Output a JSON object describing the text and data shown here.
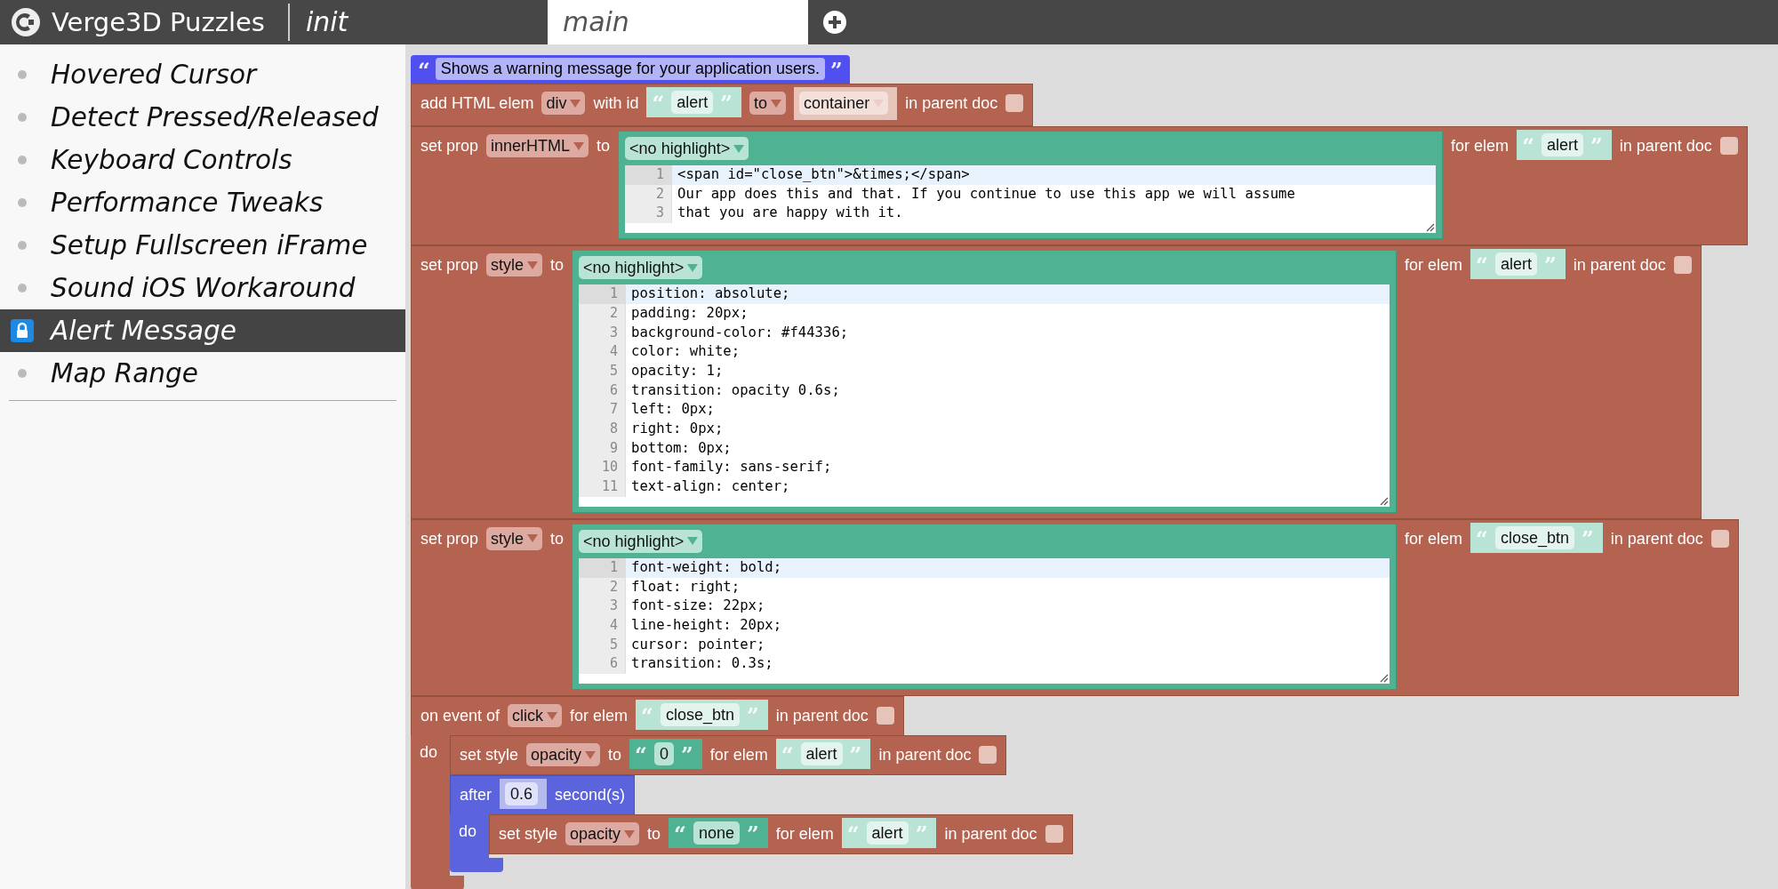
{
  "app_bar": {
    "title": "Verge3D Puzzles",
    "tabs": [
      {
        "label": "init",
        "selected": false
      },
      {
        "label": "main",
        "selected": true
      }
    ]
  },
  "sidebar": {
    "items": [
      {
        "label": "Hovered Cursor",
        "selected": false
      },
      {
        "label": "Detect Pressed/Released",
        "selected": false
      },
      {
        "label": "Keyboard Controls",
        "selected": false
      },
      {
        "label": "Performance Tweaks",
        "selected": false
      },
      {
        "label": "Setup Fullscreen iFrame",
        "selected": false
      },
      {
        "label": "Sound iOS Workaround",
        "selected": false
      },
      {
        "label": "Alert Message",
        "selected": true
      },
      {
        "label": "Map Range",
        "selected": false
      }
    ]
  },
  "workspace": {
    "comment": {
      "open": "“",
      "text": "Shows a warning message for your application users.",
      "close": "”"
    },
    "blocks": [
      {
        "kind": "statement",
        "parts": [
          {
            "kind": "label",
            "text": "add HTML elem"
          },
          {
            "kind": "dropdown",
            "value": "div"
          },
          {
            "kind": "label",
            "text": "with id"
          },
          {
            "kind": "string",
            "open": "“",
            "value": "alert",
            "close": "”"
          },
          {
            "kind": "dropdown",
            "value": "to"
          },
          {
            "kind": "dropdown_block",
            "value": "container",
            "disabled": true
          },
          {
            "kind": "label",
            "text": "in parent doc"
          },
          {
            "kind": "checkbox",
            "checked": false
          }
        ]
      },
      {
        "kind": "statement",
        "parts": [
          {
            "kind": "label",
            "text": "set prop"
          },
          {
            "kind": "dropdown",
            "value": "innerHTML"
          },
          {
            "kind": "label",
            "text": "to"
          },
          {
            "kind": "code",
            "highlight": "<no highlight>",
            "lines": [
              {
                "number": "1",
                "text": "<span id=\"close_btn\">&times;</span>",
                "active": true
              },
              {
                "number": "2",
                "text": "Our app does this and that. If you continue to use this app we will assume",
                "active": false
              },
              {
                "number": "3",
                "text": "that you are happy with it.",
                "active": false
              }
            ]
          },
          {
            "kind": "label",
            "text": "for elem"
          },
          {
            "kind": "string",
            "open": "“",
            "value": "alert",
            "close": "”"
          },
          {
            "kind": "label",
            "text": "in parent doc"
          },
          {
            "kind": "checkbox",
            "checked": false
          }
        ]
      },
      {
        "kind": "statement",
        "parts": [
          {
            "kind": "label",
            "text": "set prop"
          },
          {
            "kind": "dropdown",
            "value": "style"
          },
          {
            "kind": "label",
            "text": "to"
          },
          {
            "kind": "code",
            "highlight": "<no highlight>",
            "lines": [
              {
                "number": "1",
                "text": "position: absolute;",
                "active": true
              },
              {
                "number": "2",
                "text": "padding: 20px;",
                "active": false
              },
              {
                "number": "3",
                "text": "background-color: #f44336;",
                "active": false
              },
              {
                "number": "4",
                "text": "color: white;",
                "active": false
              },
              {
                "number": "5",
                "text": "opacity: 1;",
                "active": false
              },
              {
                "number": "6",
                "text": "transition: opacity 0.6s;",
                "active": false
              },
              {
                "number": "7",
                "text": "left: 0px;",
                "active": false
              },
              {
                "number": "8",
                "text": "right: 0px;",
                "active": false
              },
              {
                "number": "9",
                "text": "bottom: 0px;",
                "active": false
              },
              {
                "number": "10",
                "text": "font-family: sans-serif;",
                "active": false
              },
              {
                "number": "11",
                "text": "text-align: center;",
                "active": false
              }
            ]
          },
          {
            "kind": "label",
            "text": "for elem"
          },
          {
            "kind": "string",
            "open": "“",
            "value": "alert",
            "close": "”"
          },
          {
            "kind": "label",
            "text": "in parent doc"
          },
          {
            "kind": "checkbox",
            "checked": false
          }
        ]
      },
      {
        "kind": "statement",
        "parts": [
          {
            "kind": "label",
            "text": "set prop"
          },
          {
            "kind": "dropdown",
            "value": "style"
          },
          {
            "kind": "label",
            "text": "to"
          },
          {
            "kind": "code",
            "highlight": "<no highlight>",
            "lines": [
              {
                "number": "1",
                "text": "font-weight: bold;",
                "active": true
              },
              {
                "number": "2",
                "text": "float: right;",
                "active": false
              },
              {
                "number": "3",
                "text": "font-size: 22px;",
                "active": false
              },
              {
                "number": "4",
                "text": "line-height: 20px;",
                "active": false
              },
              {
                "number": "5",
                "text": "cursor: pointer;",
                "active": false
              },
              {
                "number": "6",
                "text": "transition: 0.3s;",
                "active": false
              }
            ]
          },
          {
            "kind": "label",
            "text": "for elem"
          },
          {
            "kind": "string",
            "open": "“",
            "value": "close_btn",
            "close": "”"
          },
          {
            "kind": "label",
            "text": "in parent doc"
          },
          {
            "kind": "checkbox",
            "checked": false
          }
        ]
      },
      {
        "kind": "event",
        "parts": [
          {
            "kind": "label",
            "text": "on event of"
          },
          {
            "kind": "dropdown",
            "value": "click"
          },
          {
            "kind": "label",
            "text": "for elem"
          },
          {
            "kind": "string",
            "open": "“",
            "value": "close_btn",
            "close": "”"
          },
          {
            "kind": "label",
            "text": "in parent doc"
          },
          {
            "kind": "checkbox",
            "checked": false
          }
        ],
        "do_label": "do",
        "body": [
          {
            "kind": "statement",
            "parts": [
              {
                "kind": "label",
                "text": "set style"
              },
              {
                "kind": "dropdown",
                "value": "opacity"
              },
              {
                "kind": "label",
                "text": "to"
              },
              {
                "kind": "value_string",
                "open": "“",
                "value": "0",
                "close": "”"
              },
              {
                "kind": "label",
                "text": "for elem"
              },
              {
                "kind": "string",
                "open": "“",
                "value": "alert",
                "close": "”"
              },
              {
                "kind": "label",
                "text": "in parent doc"
              },
              {
                "kind": "checkbox",
                "checked": false
              }
            ]
          },
          {
            "kind": "timer",
            "parts": [
              {
                "kind": "label",
                "text": "after"
              },
              {
                "kind": "number",
                "value": "0.6"
              },
              {
                "kind": "label",
                "text": "second(s)"
              }
            ],
            "do_label": "do",
            "body": [
              {
                "kind": "statement",
                "parts": [
                  {
                    "kind": "label",
                    "text": "set style"
                  },
                  {
                    "kind": "dropdown",
                    "value": "opacity"
                  },
                  {
                    "kind": "label",
                    "text": "to"
                  },
                  {
                    "kind": "value_string",
                    "open": "“",
                    "value": "none",
                    "close": "”"
                  },
                  {
                    "kind": "label",
                    "text": "for elem"
                  },
                  {
                    "kind": "string",
                    "open": "“",
                    "value": "alert",
                    "close": "”"
                  },
                  {
                    "kind": "label",
                    "text": "in parent doc"
                  },
                  {
                    "kind": "checkbox",
                    "checked": false
                  }
                ]
              }
            ]
          }
        ]
      }
    ]
  }
}
